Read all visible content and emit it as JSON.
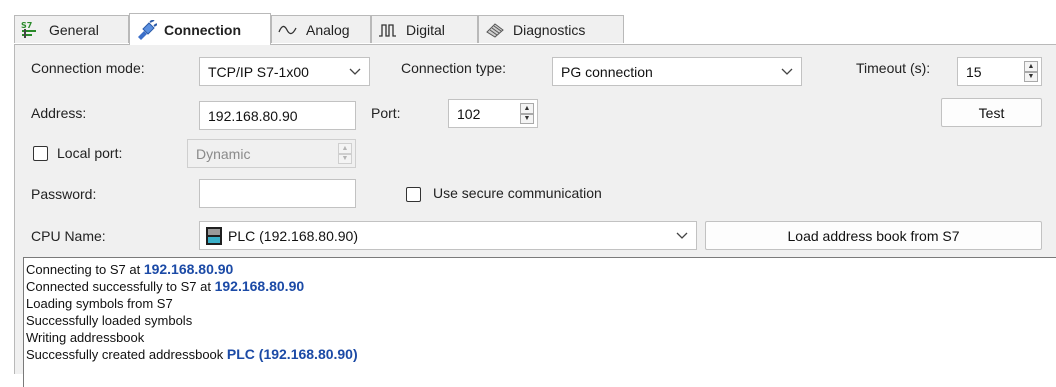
{
  "tabs": [
    {
      "label": "General",
      "icon": "s7-general-icon",
      "active": false
    },
    {
      "label": "Connection",
      "icon": "connection-plug-icon",
      "active": true
    },
    {
      "label": "Analog",
      "icon": "analog-wave-icon",
      "active": false
    },
    {
      "label": "Digital",
      "icon": "digital-pulse-icon",
      "active": false
    },
    {
      "label": "Diagnostics",
      "icon": "diagnostics-chip-icon",
      "active": false
    }
  ],
  "connection": {
    "mode_label": "Connection mode:",
    "mode_value": "TCP/IP S7-1x00",
    "type_label": "Connection type:",
    "type_value": "PG connection",
    "timeout_label": "Timeout (s):",
    "timeout_value": "15",
    "address_label": "Address:",
    "address_value": "192.168.80.90",
    "port_label": "Port:",
    "port_value": "102",
    "test_button": "Test",
    "local_port_label": "Local port:",
    "local_port_checked": false,
    "local_port_value": "Dynamic",
    "password_label": "Password:",
    "password_value": "",
    "secure_label": "Use secure communication",
    "secure_checked": false,
    "cpu_name_label": "CPU Name:",
    "cpu_name_value": "PLC (192.168.80.90)",
    "cpu_icon": "tia-portal-icon",
    "load_button": "Load address book from S7"
  },
  "log": [
    {
      "text": "Connecting to S7 at ",
      "highlight": "192.168.80.90"
    },
    {
      "text": "Connected successfully to S7 at ",
      "highlight": "192.168.80.90"
    },
    {
      "text": "Loading symbols from S7",
      "highlight": ""
    },
    {
      "text": "Successfully loaded symbols",
      "highlight": ""
    },
    {
      "text": "Writing addressbook",
      "highlight": ""
    },
    {
      "text": "Successfully created addressbook ",
      "highlight": "PLC (192.168.80.90)"
    }
  ],
  "colors": {
    "log_highlight": "#1b4aa6",
    "panel_bg": "#f0f0f0",
    "connection_icon": "#3b6fc9"
  }
}
